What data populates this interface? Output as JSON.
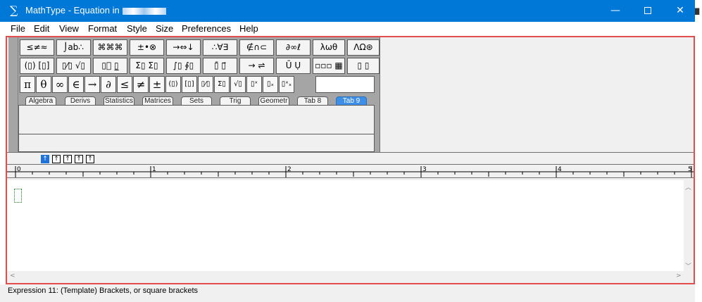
{
  "titlebar": {
    "icon": "∑",
    "title": "MathType - Equation in",
    "minimize_glyph": "—",
    "close_glyph": "✕"
  },
  "menu": [
    "File",
    "Edit",
    "View",
    "Format",
    "Style",
    "Size",
    "Preferences",
    "Help"
  ],
  "palette_row1": [
    "≤≠≈",
    "⌡ab∴",
    "⌘⌘⌘",
    "±•⊗",
    "→⇔↓",
    "∴∀∃",
    "∉∩⊂",
    "∂∞ℓ",
    "λωθ",
    "ΛΩ⊛"
  ],
  "palette_row2": [
    "(▯) [▯]",
    "▯⁄▯ √▯",
    "▯⃞ ▯̲",
    "Σ▯ Σ▯",
    "∫▯ ∮▯",
    "▯̄ ▯⃗",
    "→ ⇌",
    "Ū Ụ",
    "▫▫▫ ▦",
    "▯ ▯"
  ],
  "symbol_strip": [
    "π",
    "θ",
    "∞",
    "∈",
    "→",
    "∂",
    "≤",
    "≠",
    "±",
    "(▯)",
    "[▯]",
    "▯⁄▯",
    "Σ▯",
    "√▯",
    "▯ˣ",
    "▯ₓ",
    "▯ˣₓ"
  ],
  "tabs": [
    "Algebra",
    "Derivs",
    "Statistics",
    "Matrices",
    "Sets",
    "Trig",
    "Geometr",
    "Tab 8",
    "Tab 9"
  ],
  "active_tab": "Tab 9",
  "size_buttons": [
    "↑",
    "↑",
    "↑",
    "↑",
    "↑"
  ],
  "ruler_labels": [
    "0",
    "1",
    "2",
    "3",
    "4",
    "5"
  ],
  "status_text": "Expression 11: (Template) Brackets, or square brackets",
  "colors": {
    "titlebar": "#0078d7",
    "window_border": "#e34d4d",
    "active_tab": "#3c8ee6",
    "cursor_box": "#1b7a1b"
  }
}
